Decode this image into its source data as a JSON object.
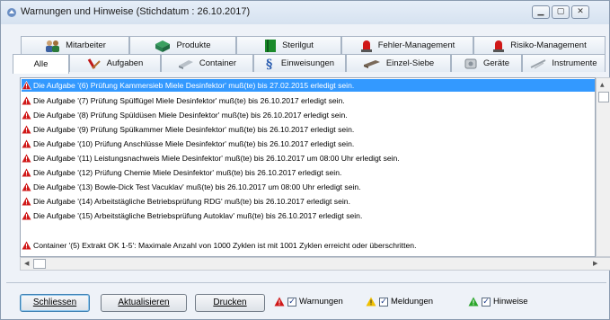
{
  "window": {
    "title": "Warnungen und Hinweise (Stichdatum : 26.10.2017)",
    "controls": [
      "minimize-icon",
      "maximize-icon",
      "close-icon"
    ]
  },
  "tabs_row1": [
    {
      "label": "Mitarbeiter",
      "icon": "people-icon"
    },
    {
      "label": "Produkte",
      "icon": "products-icon"
    },
    {
      "label": "Sterilgut",
      "icon": "book-icon"
    },
    {
      "label": "Fehler-Management",
      "icon": "red-alarm-icon"
    },
    {
      "label": "Risiko-Management",
      "icon": "red-alarm-icon"
    }
  ],
  "tabs_row2": [
    {
      "label": "Alle",
      "active": true
    },
    {
      "label": "Aufgaben",
      "icon": "tasks-icon"
    },
    {
      "label": "Container",
      "icon": "container-icon"
    },
    {
      "label": "Einweisungen",
      "icon": "paragraph-icon"
    },
    {
      "label": "Einzel-Siebe",
      "icon": "tray-icon"
    },
    {
      "label": "Geräte",
      "icon": "device-icon"
    },
    {
      "label": "Instrumente",
      "icon": "instrument-icon"
    }
  ],
  "messages": [
    {
      "text": "Die Aufgabe '(6) Prüfung Kammersieb Miele Desinfektor' muß(te) bis 27.02.2015 erledigt sein.",
      "selected": true
    },
    {
      "text": "Die Aufgabe '(7) Prüfung Spülflügel Miele Desinfektor' muß(te) bis 26.10.2017 erledigt sein."
    },
    {
      "text": "Die Aufgabe '(8) Prüfung Spüldüsen Miele Desinfektor' muß(te) bis 26.10.2017 erledigt sein."
    },
    {
      "text": "Die Aufgabe '(9) Prüfung Spülkammer Miele Desinfektor' muß(te) bis 26.10.2017 erledigt sein."
    },
    {
      "text": "Die Aufgabe '(10) Prüfung Anschlüsse Miele Desinfektor' muß(te) bis 26.10.2017 erledigt sein."
    },
    {
      "text": "Die Aufgabe '(11) Leistungsnachweis Miele Desinfektor' muß(te) bis 26.10.2017 um 08:00 Uhr erledigt sein."
    },
    {
      "text": "Die Aufgabe '(12) Prüfung Chemie Miele Desinfektor' muß(te) bis 26.10.2017 erledigt sein."
    },
    {
      "text": "Die Aufgabe '(13) Bowle-Dick Test Vacuklav' muß(te) bis 26.10.2017 um 08:00 Uhr erledigt sein."
    },
    {
      "text": "Die Aufgabe '(14) Arbeitstägliche Betriebsprüfung RDG' muß(te) bis 26.10.2017 erledigt sein."
    },
    {
      "text": "Die Aufgabe '(15) Arbeitstägliche Betriebsprüfung Autoklav' muß(te) bis 26.10.2017 erledigt sein."
    },
    {
      "text": "Container '(5) Extrakt OK 1-5':   Maximale Anzahl von 1000 Zyklen ist mit 1001 Zyklen erreicht oder überschritten."
    }
  ],
  "buttons": {
    "close": "Schliessen",
    "refresh": "Aktualisieren",
    "print": "Drucken"
  },
  "filters": [
    {
      "label": "Warnungen",
      "checked": true,
      "color": "#d01818"
    },
    {
      "label": "Meldungen",
      "checked": true,
      "color": "#f0c000"
    },
    {
      "label": "Hinweise",
      "checked": true,
      "color": "#2aa52a"
    }
  ],
  "colors": {
    "selection": "#3399ff",
    "warning": "#d01818"
  }
}
